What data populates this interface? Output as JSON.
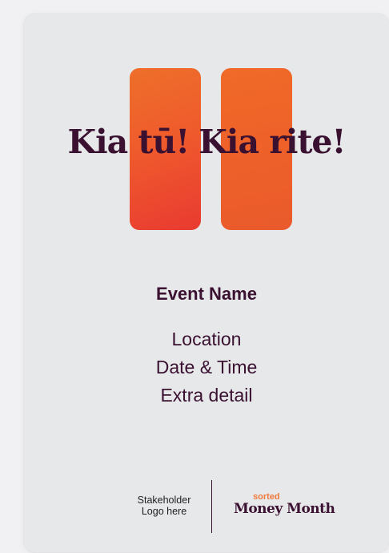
{
  "poster": {
    "headline": {
      "part1": "Kia tū!",
      "part2": "Kia rite!"
    },
    "event_name": "Event Name",
    "details": [
      "Location",
      "Date & Time",
      "Extra detail"
    ],
    "stakeholder": {
      "line1": "Stakeholder",
      "line2": "Logo here"
    },
    "brand": {
      "small": "sorted",
      "main": "Money Month"
    }
  },
  "colors": {
    "background": "#f1f1f3",
    "card": "#e7e8ea",
    "text": "#3a1130",
    "accent_orange": "#ef6a2a",
    "accent_red": "#e93a31"
  }
}
